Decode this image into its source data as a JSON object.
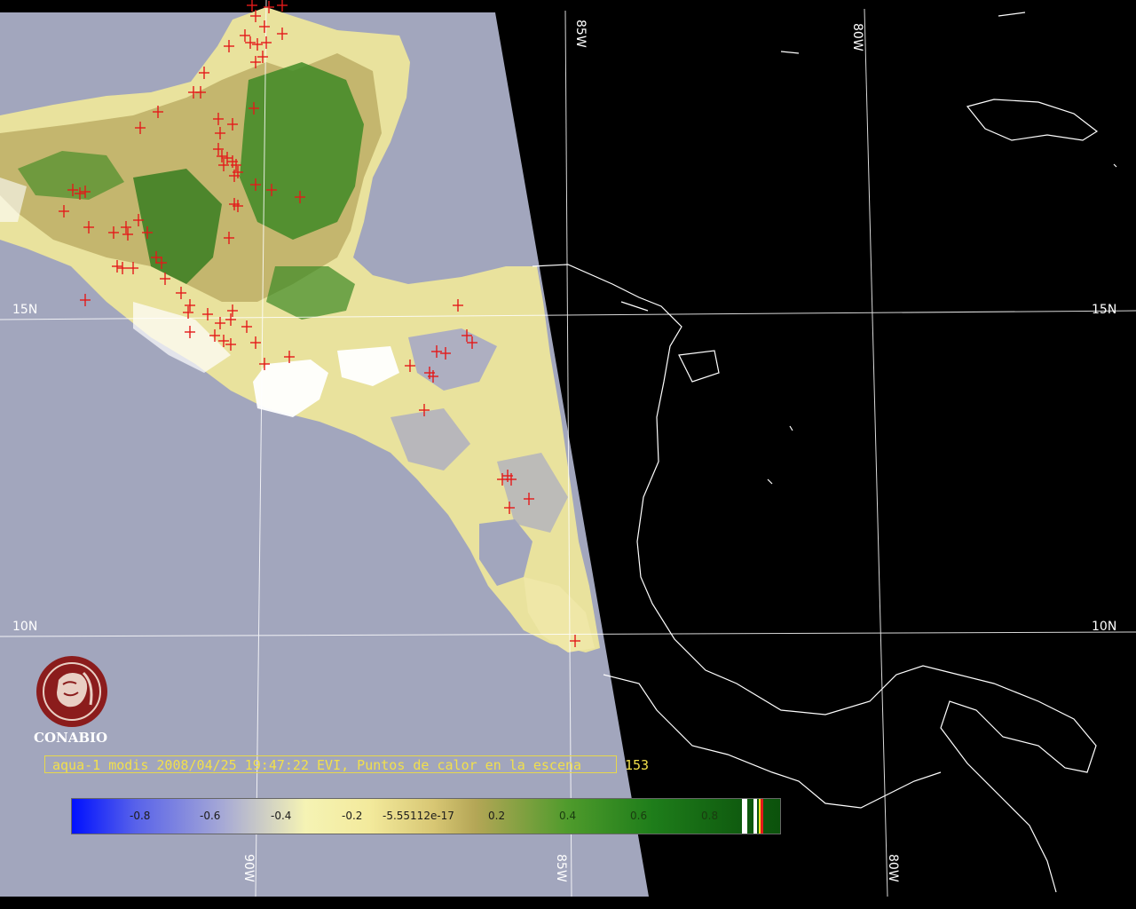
{
  "map": {
    "latitude_labels": [
      "15N",
      "10N"
    ],
    "longitude_labels_bottom": [
      "90W",
      "85W",
      "80W"
    ],
    "longitude_labels_top": [
      "85W",
      "80W"
    ],
    "colors": {
      "background": "#000000",
      "no_data_panel": "#a2a6bd",
      "coastline": "#ffffff",
      "gridline": "#ffffff",
      "hotspot_marker": "#e31a1a"
    },
    "hotspot_icon": "red-cross-marker"
  },
  "caption": {
    "text": "aqua-1 modis 2008/04/25 19:47:22 EVI, Puntos de calor en la escena",
    "count": "153"
  },
  "colorbar": {
    "ticks": [
      "-0.8",
      "-0.6",
      "-0.4",
      "-0.2",
      "-5.55112e-17",
      "0.2",
      "0.4",
      "0.6",
      "0.8"
    ],
    "colors": [
      "#0010ff",
      "#a4a7d6",
      "#f5f3b4",
      "#b4a656",
      "#1e7d1a",
      "#0c520c"
    ]
  },
  "logo": {
    "text": "CONABIO",
    "color": "#8b1c1c"
  }
}
